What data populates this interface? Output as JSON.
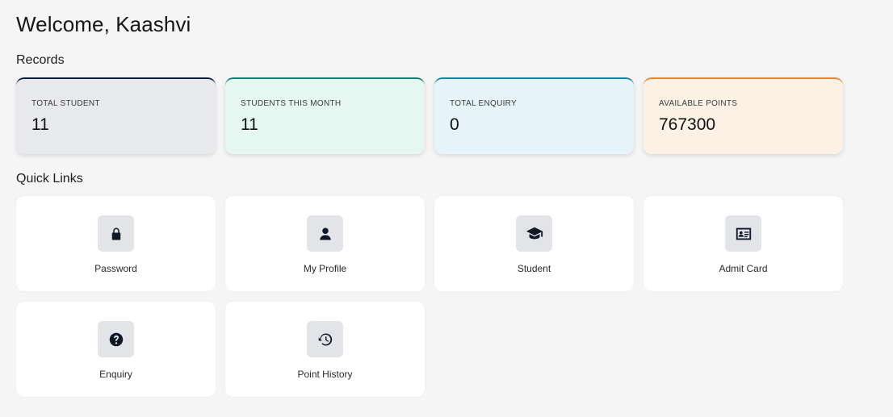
{
  "welcome": "Welcome, Kaashvi",
  "records_title": "Records",
  "quick_links_title": "Quick Links",
  "stats": [
    {
      "label": "TOTAL STUDENT",
      "value": "11",
      "bg": "#e8e9ec",
      "accent": "#0c1a3a"
    },
    {
      "label": "STUDENTS THIS MONTH",
      "value": "11",
      "bg": "#e6f6f1",
      "accent": "#157c74"
    },
    {
      "label": "TOTAL ENQUIRY",
      "value": "0",
      "bg": "#e6f3fa",
      "accent": "#1b7fa0"
    },
    {
      "label": "AVAILABLE POINTS",
      "value": "767300",
      "bg": "#fdf1e5",
      "accent": "#e0883a"
    }
  ],
  "links": [
    {
      "label": "Password",
      "icon": "lock-icon"
    },
    {
      "label": "My Profile",
      "icon": "user-icon"
    },
    {
      "label": "Student",
      "icon": "graduation-cap-icon"
    },
    {
      "label": "Admit Card",
      "icon": "id-card-icon"
    },
    {
      "label": "Enquiry",
      "icon": "question-circle-icon"
    },
    {
      "label": "Point History",
      "icon": "history-icon"
    }
  ]
}
